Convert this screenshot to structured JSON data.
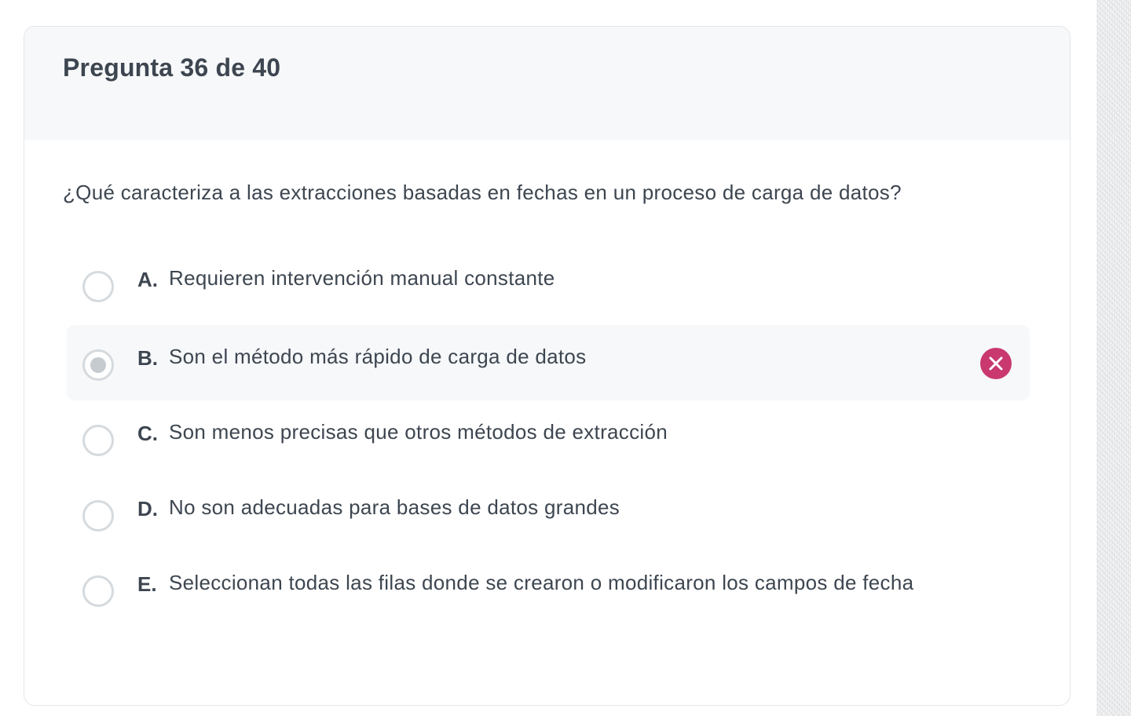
{
  "quiz": {
    "header_title": "Pregunta 36 de 40",
    "question": "¿Qué caracteriza a las extracciones basadas en fechas en un proceso de carga de datos?",
    "options": [
      {
        "letter": "A.",
        "text": "Requieren intervención manual constante",
        "selected": false
      },
      {
        "letter": "B.",
        "text": "Son el método más rápido de carga de datos",
        "selected": true,
        "status": "incorrect"
      },
      {
        "letter": "C.",
        "text": "Son menos precisas que otros métodos de extracción",
        "selected": false
      },
      {
        "letter": "D.",
        "text": "No son adecuadas para bases de datos grandes",
        "selected": false
      },
      {
        "letter": "E.",
        "text": "Seleccionan todas las filas donde se crearon o modificaron los campos de fecha",
        "selected": false
      }
    ],
    "incorrect_icon": "close-circle-icon"
  },
  "colors": {
    "text": "#3d4650",
    "header_bg": "#f7f8fa",
    "selected_bg": "#f6f8fa",
    "radio_border": "#d5dade",
    "incorrect": "#c9386f"
  }
}
